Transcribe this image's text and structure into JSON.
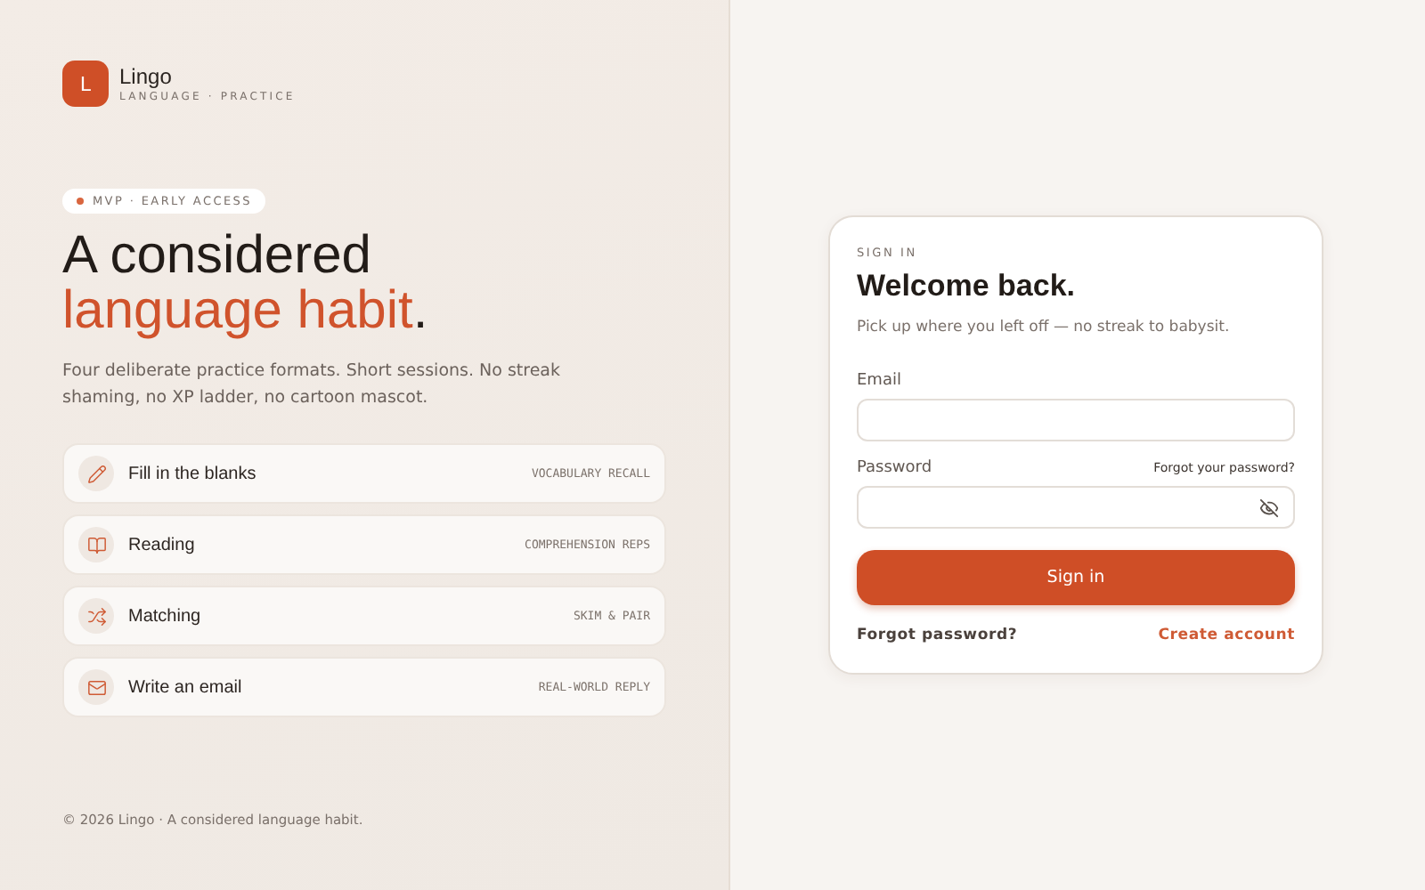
{
  "brand": {
    "initial": "L",
    "name": "Lingo",
    "tagline": "LANGUAGE · PRACTICE"
  },
  "badge": "MVP · EARLY ACCESS",
  "heading": {
    "line_1": "A considered",
    "accent": "language habit",
    "end": "."
  },
  "intro": "Four deliberate practice formats. Short sessions. No streak shaming, no XP ladder, no cartoon mascot.",
  "features": [
    {
      "kind": "pencil",
      "title": "Fill in the blanks",
      "tag": "VOCABULARY RECALL"
    },
    {
      "kind": "book",
      "title": "Reading",
      "tag": "COMPREHENSION REPS"
    },
    {
      "kind": "shuffle",
      "title": "Matching",
      "tag": "SKIM & PAIR"
    },
    {
      "kind": "mail",
      "title": "Write an email",
      "tag": "REAL-WORLD REPLY"
    }
  ],
  "footer": "© 2026 Lingo · A considered language habit.",
  "sign_in": {
    "eyebrow": "SIGN IN",
    "title": "Welcome back.",
    "subtitle": "Pick up where you left off — no streak to babysit.",
    "email_label": "Email",
    "password_label": "Password",
    "forgot_inline": "Forgot your password?",
    "password_hidden": true,
    "submit": "Sign in",
    "forgot": "Forgot password?",
    "create": "Create account"
  }
}
